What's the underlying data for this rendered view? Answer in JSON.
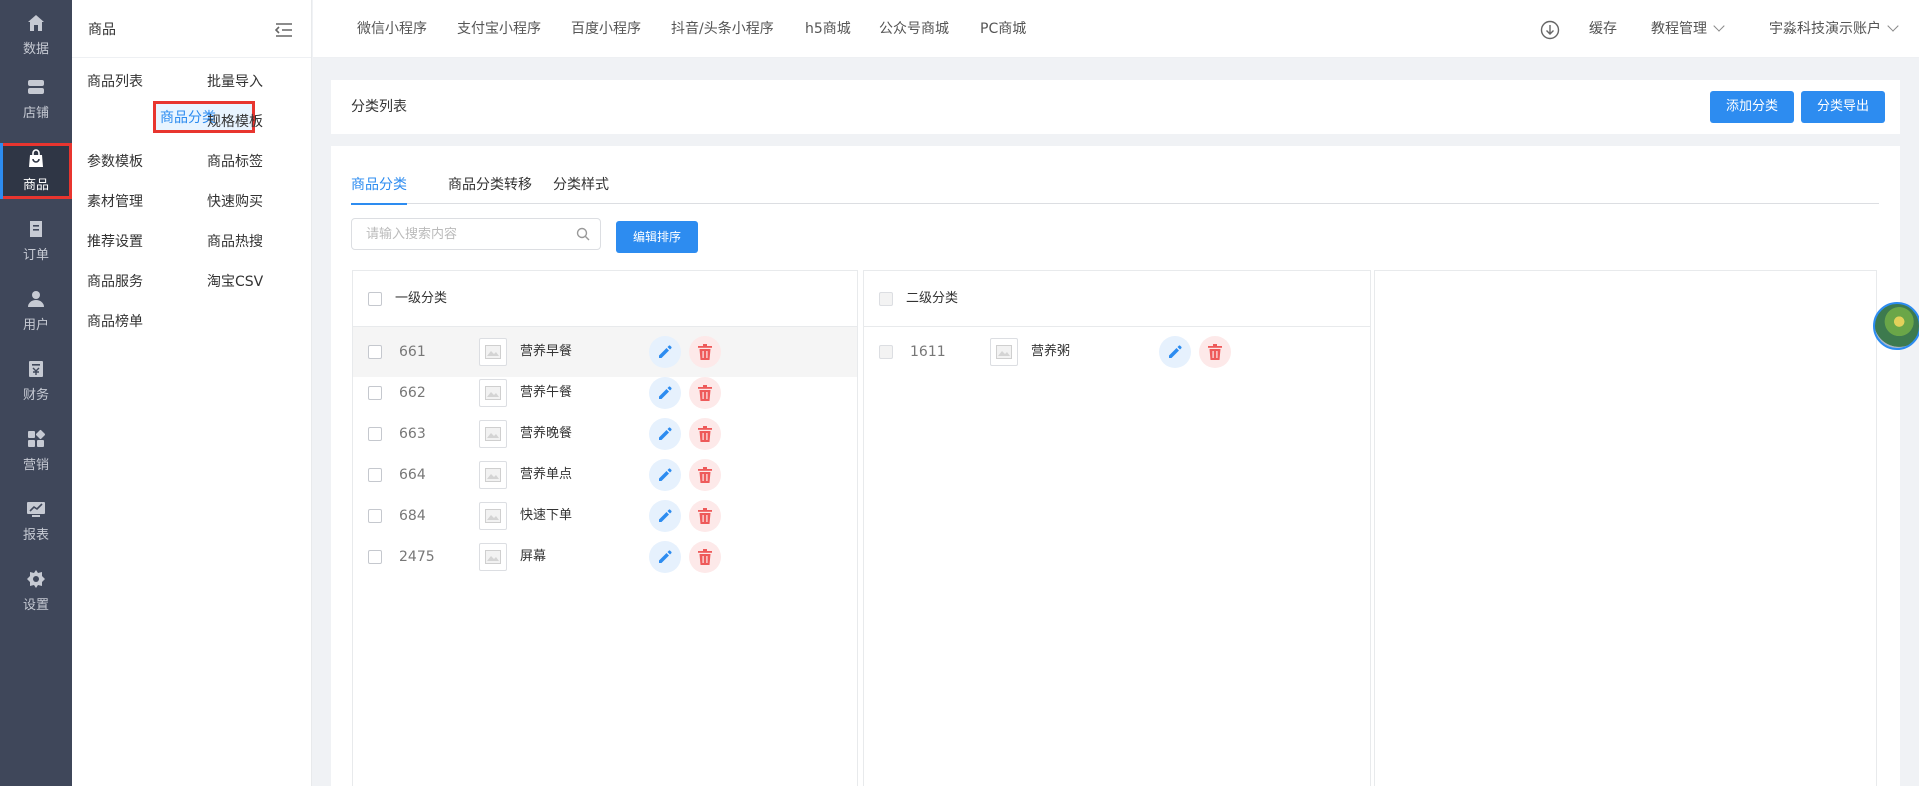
{
  "rail": {
    "items": [
      {
        "label": "数据",
        "icon": "home-icon"
      },
      {
        "label": "店铺",
        "icon": "store-icon"
      },
      {
        "label": "商品",
        "icon": "shopping-bag-icon"
      },
      {
        "label": "订单",
        "icon": "order-icon"
      },
      {
        "label": "用户",
        "icon": "user-icon"
      },
      {
        "label": "财务",
        "icon": "finance-icon"
      },
      {
        "label": "营销",
        "icon": "marketing-icon"
      },
      {
        "label": "报表",
        "icon": "report-icon"
      },
      {
        "label": "设置",
        "icon": "settings-icon"
      }
    ],
    "active_index": 2
  },
  "submenu": {
    "title": "商品",
    "left_items": [
      "商品列表",
      "商品分类",
      "参数模板",
      "素材管理",
      "推荐设置",
      "商品服务",
      "商品榜单"
    ],
    "right_items": [
      "批量导入",
      "规格模板",
      "商品标签",
      "快速购买",
      "商品热搜",
      "淘宝CSV"
    ],
    "active": "商品分类"
  },
  "topbar": {
    "nav": [
      "微信小程序",
      "支付宝小程序",
      "百度小程序",
      "抖音/头条小程序",
      "h5商城",
      "公众号商城",
      "PC商城"
    ],
    "cache_label": "缓存",
    "tutorial_label": "教程管理",
    "account_label": "宇淼科技演示账户"
  },
  "header_card": {
    "title": "分类列表",
    "add_button": "添加分类",
    "export_button": "分类导出"
  },
  "tabs": [
    "商品分类",
    "商品分类转移",
    "分类样式"
  ],
  "search": {
    "placeholder": "请输入搜索内容",
    "value": ""
  },
  "sort_button": "编辑排序",
  "level1": {
    "header": "一级分类",
    "rows": [
      {
        "id": "661",
        "name": "营养早餐"
      },
      {
        "id": "662",
        "name": "营养午餐"
      },
      {
        "id": "663",
        "name": "营养晚餐"
      },
      {
        "id": "664",
        "name": "营养单点"
      },
      {
        "id": "684",
        "name": "快速下单"
      },
      {
        "id": "2475",
        "name": "屏幕"
      }
    ]
  },
  "level2": {
    "header": "二级分类",
    "rows": [
      {
        "id": "1611",
        "name": "营养粥"
      }
    ]
  },
  "colors": {
    "primary": "#2d8cf0",
    "rail_bg": "#3f475a",
    "danger": "#ee5a5a",
    "highlight_outline": "#e8352f"
  }
}
